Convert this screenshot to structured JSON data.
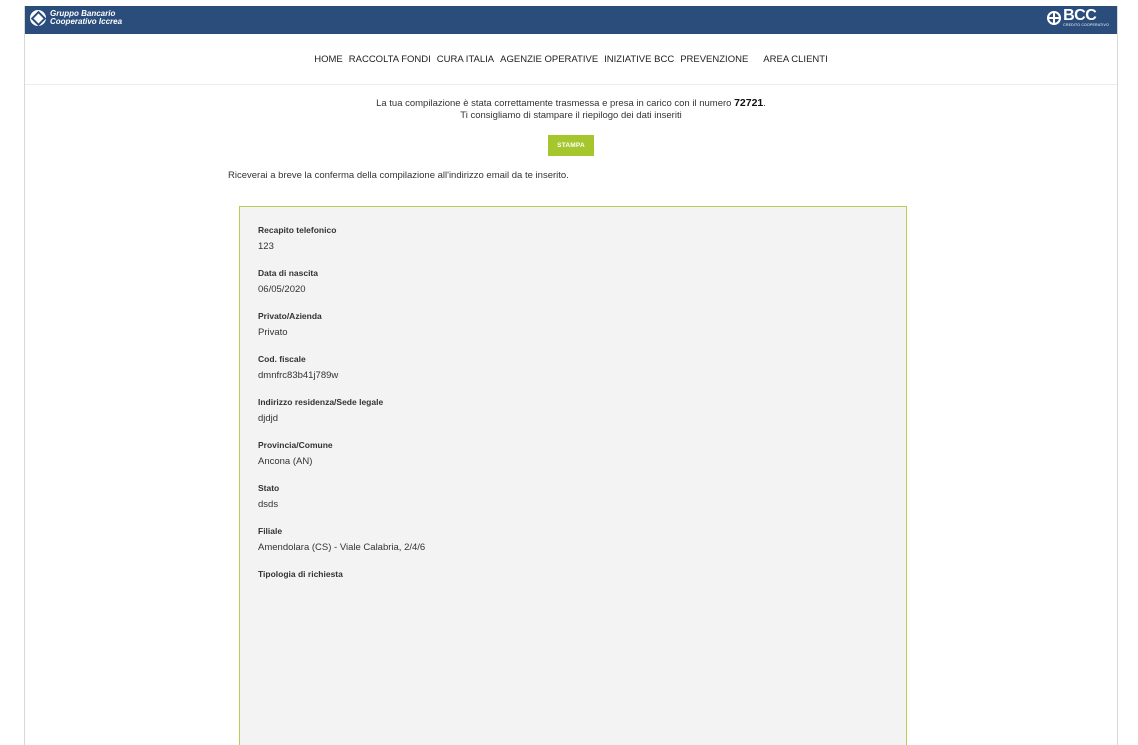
{
  "brand": {
    "line1": "Gruppo Bancario",
    "line2": "Cooperativo Iccrea",
    "bcc_text": "BCC",
    "bcc_sub": "CREDITO COOPERATIVO"
  },
  "nav": {
    "items": [
      "HOME",
      "RACCOLTA FONDI",
      "CURA ITALIA",
      "AGENZIE OPERATIVE",
      "INIZIATIVE BCC",
      "PREVENZIONE",
      "AREA CLIENTI"
    ]
  },
  "notice": {
    "line1_prefix": "La tua compilazione è stata correttamente trasmessa e presa in carico con il numero",
    "number": "72721",
    "line1_suffix": ".",
    "line2": "Ti consigliamo di stampare il riepilogo dei dati inseriti"
  },
  "print_button": "STAMPA",
  "confirm_text": "Riceverai a breve la conferma della compilazione all'indirizzo email da te inserito.",
  "fields": [
    {
      "label": "Recapito telefonico",
      "value": "123"
    },
    {
      "label": "Data di nascita",
      "value": "06/05/2020"
    },
    {
      "label": "Privato/Azienda",
      "value": "Privato"
    },
    {
      "label": "Cod. fiscale",
      "value": "dmnfrc83b41j789w"
    },
    {
      "label": "Indirizzo residenza/Sede legale",
      "value": "djdjd"
    },
    {
      "label": "Provincia/Comune",
      "value": "Ancona (AN)"
    },
    {
      "label": "Stato",
      "value": "dsds"
    },
    {
      "label": "Filiale",
      "value": "Amendolara (CS) - Viale Calabria, 2/4/6"
    },
    {
      "label": "Tipologia di richiesta",
      "value": ""
    }
  ],
  "colors": {
    "topbar": "#2b4d7c",
    "accent_green": "#a6c62e",
    "panel_border": "#b4cf55",
    "panel_bg": "#f3f3f3"
  }
}
